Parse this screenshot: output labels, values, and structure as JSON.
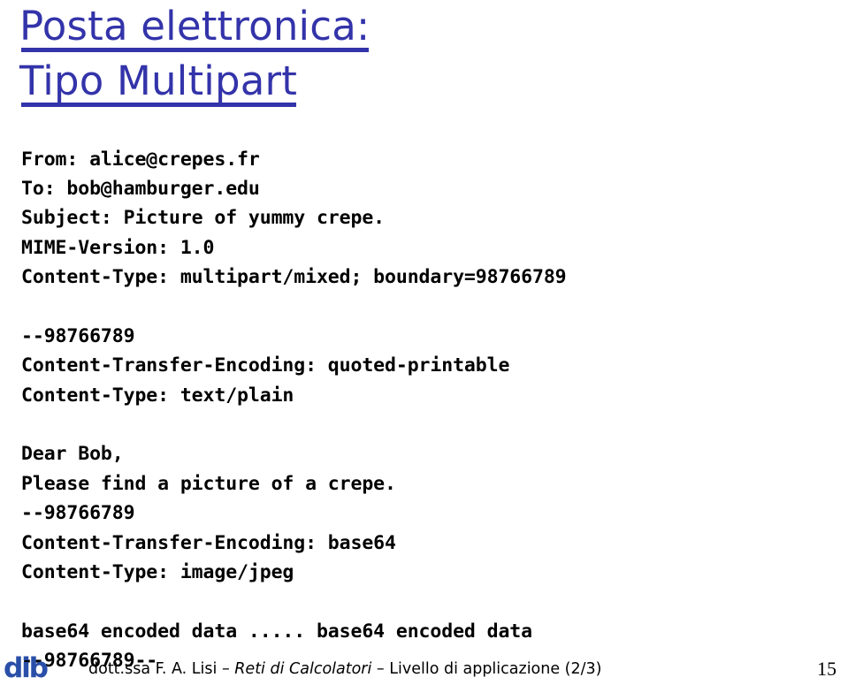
{
  "slide": {
    "title_line_1": "Posta elettronica:",
    "title_line_2": "Tipo Multipart",
    "title_color": "#3333AA"
  },
  "mail": {
    "lines": [
      "From: alice@crepes.fr",
      "To: bob@hamburger.edu",
      "Subject: Picture of yummy crepe.",
      "MIME-Version: 1.0",
      "Content-Type: multipart/mixed; boundary=98766789",
      "",
      "--98766789",
      "Content-Transfer-Encoding: quoted-printable",
      "Content-Type: text/plain",
      "",
      "Dear Bob,",
      "Please find a picture of a crepe.",
      "--98766789",
      "Content-Transfer-Encoding: base64",
      "Content-Type: image/jpeg",
      "",
      "base64 encoded data ..... base64 encoded data",
      "--98766789--"
    ]
  },
  "footer": {
    "logo_text": "dib",
    "logo_color": "#2A4FA8",
    "credit_prefix": "dott.ssa F. A. Lisi – ",
    "credit_emphasis": "Reti di Calcolatori",
    "credit_suffix": " – Livello di applicazione (2/3)",
    "page_number": "15"
  }
}
